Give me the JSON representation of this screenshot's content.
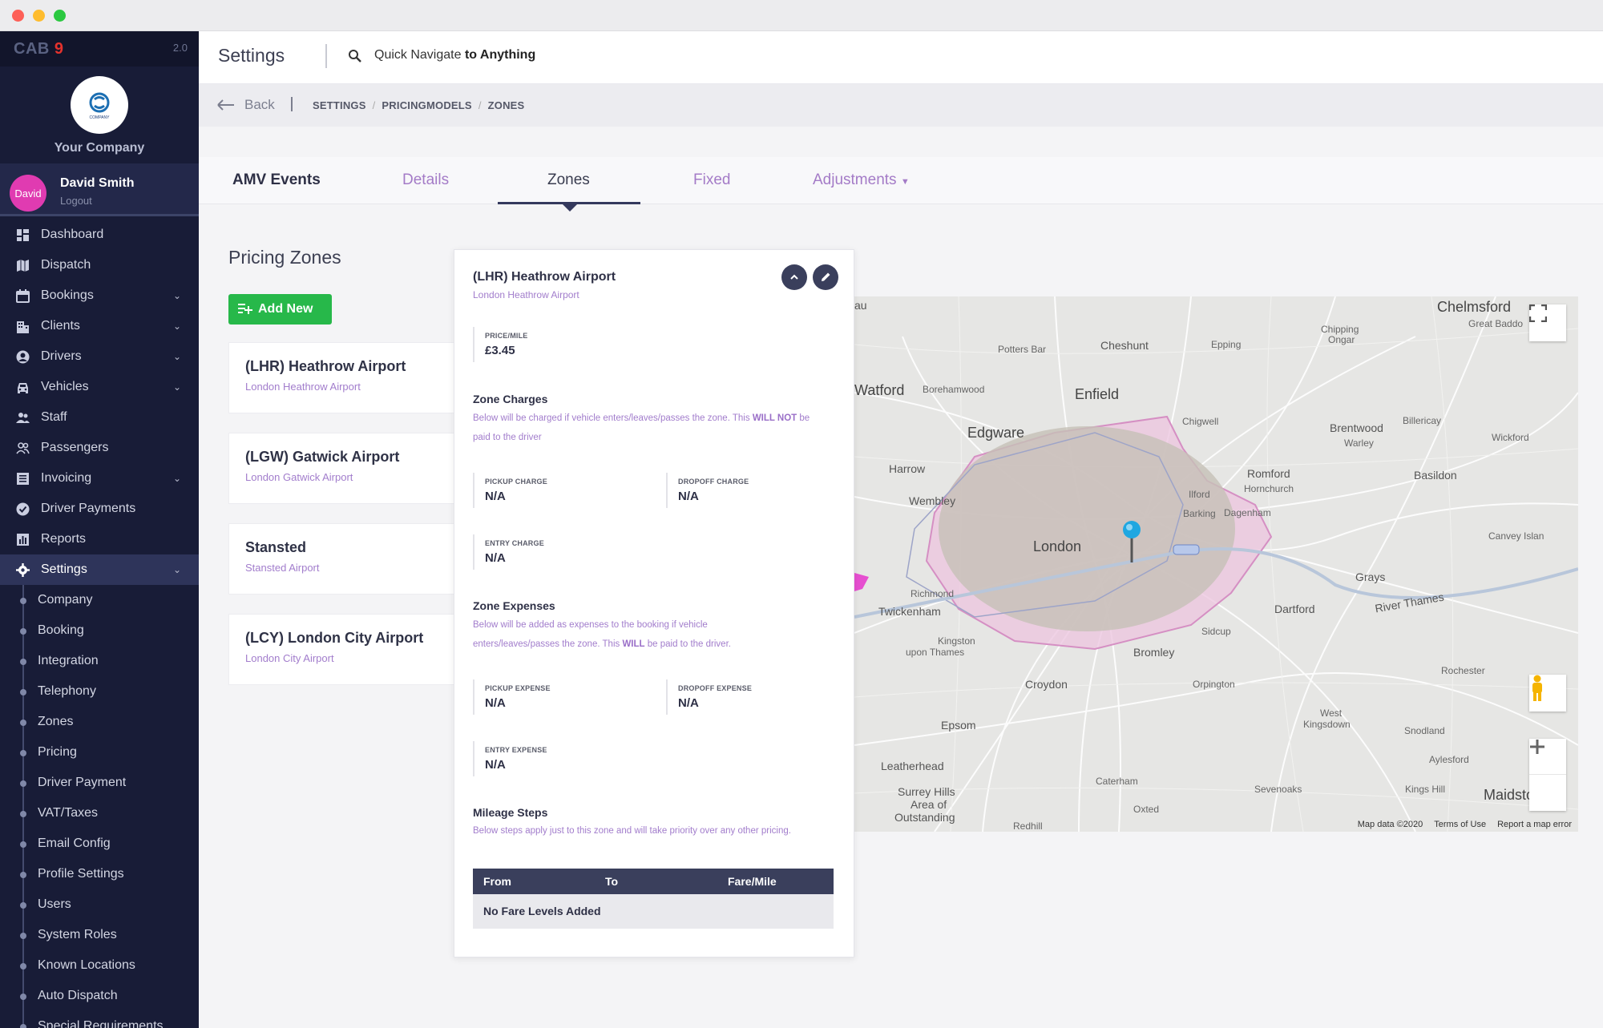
{
  "app": {
    "brand": "CAB",
    "brand_num": "9",
    "version": "2.0",
    "company_name": "Your Company",
    "logo_text": "COMPANY"
  },
  "user": {
    "avatar_text": "David",
    "name": "David Smith",
    "logout_label": "Logout"
  },
  "nav": {
    "dashboard": "Dashboard",
    "dispatch": "Dispatch",
    "bookings": "Bookings",
    "clients": "Clients",
    "drivers": "Drivers",
    "vehicles": "Vehicles",
    "staff": "Staff",
    "passengers": "Passengers",
    "invoicing": "Invoicing",
    "driver_payments": "Driver Payments",
    "reports": "Reports",
    "settings": "Settings"
  },
  "subnav": [
    "Company",
    "Booking",
    "Integration",
    "Telephony",
    "Zones",
    "Pricing",
    "Driver Payment",
    "VAT/Taxes",
    "Email Config",
    "Profile Settings",
    "Users",
    "System Roles",
    "Known Locations",
    "Auto Dispatch",
    "Special Requirements"
  ],
  "header": {
    "title": "Settings",
    "quick_nav_pre": "Quick Navigate ",
    "quick_nav_bold": "to Anything"
  },
  "breadcrumb": {
    "back": "Back",
    "items": [
      "SETTINGS",
      "PRICINGMODELS",
      "ZONES"
    ]
  },
  "tabs": {
    "title": "AMV Events",
    "details": "Details",
    "zones": "Zones",
    "fixed": "Fixed",
    "adjustments": "Adjustments"
  },
  "zones_page": {
    "title": "Pricing Zones",
    "add_new": "Add New",
    "zones": [
      {
        "name": "(LHR) Heathrow Airport",
        "sub": "London Heathrow Airport"
      },
      {
        "name": "(LGW) Gatwick Airport",
        "sub": "London Gatwick Airport"
      },
      {
        "name": "Stansted",
        "sub": "Stansted Airport"
      },
      {
        "name": "(LCY) London City Airport",
        "sub": "London City Airport"
      }
    ]
  },
  "detail": {
    "title": "(LHR) Heathrow Airport",
    "subtitle": "London Heathrow Airport",
    "price_label": "PRICE/MILE",
    "price_value": "£3.45",
    "charges_title": "Zone Charges",
    "charges_desc_1": "Below will be charged if vehicle enters/leaves/passes the zone. This ",
    "charges_desc_b1": "WILL NOT",
    "charges_desc_2": " be paid to the driver",
    "pickup_charge_label": "PICKUP CHARGE",
    "pickup_charge": "N/A",
    "dropoff_charge_label": "DROPOFF CHARGE",
    "dropoff_charge": "N/A",
    "entry_charge_label": "ENTRY CHARGE",
    "entry_charge": "N/A",
    "expenses_title": "Zone Expenses",
    "expenses_desc_1": "Below will be added as expenses to the booking if vehicle enters/leaves/passes the zone. This ",
    "expenses_desc_b1": "WILL",
    "expenses_desc_2": " be paid to the driver.",
    "pickup_expense_label": "PICKUP EXPENSE",
    "pickup_expense": "N/A",
    "dropoff_expense_label": "DROPOFF EXPENSE",
    "dropoff_expense": "N/A",
    "entry_expense_label": "ENTRY EXPENSE",
    "entry_expense": "N/A",
    "mileage_title": "Mileage Steps",
    "mileage_desc": "Below steps apply just to this zone and will take priority over any other pricing.",
    "table_headers": [
      "From",
      "To",
      "Fare/Mile"
    ],
    "table_empty": "No Fare Levels Added"
  },
  "map": {
    "labels": {
      "chelmsford": "Chelmsford",
      "great_baddow": "Great Baddo",
      "chipping_ongar": "Chipping\nOngar",
      "potters_bar": "Potters Bar",
      "cheshunt": "Cheshunt",
      "epping": "Epping",
      "watford": "Watford",
      "borehamwood": "Borehamwood",
      "enfield": "Enfield",
      "chigwell": "Chigwell",
      "brentwood": "Brentwood",
      "warley": "Warley",
      "billericay": "Billericay",
      "wickford": "Wickford",
      "edgware": "Edgware",
      "harrow": "Harrow",
      "wembley": "Wembley",
      "romford": "Romford",
      "hornchurch": "Hornchurch",
      "basildon": "Basildon",
      "ilford": "Ilford",
      "barking": "Barking",
      "dagenham": "Dagenham",
      "london": "London",
      "canvey": "Canvey Islan",
      "richmond": "Richmond",
      "twickenham": "Twickenham",
      "kingston": "Kingston\nupon Thames",
      "bromley": "Bromley",
      "sidcup": "Sidcup",
      "dartford": "Dartford",
      "grays": "Grays",
      "river_thames": "River Thames",
      "croydon": "Croydon",
      "orpington": "Orpington",
      "rochester": "Rochester",
      "epsom": "Epsom",
      "west_kingsdown": "West\nKingsdown",
      "snodland": "Snodland",
      "aylesford": "Aylesford",
      "leatherhead": "Leatherhead",
      "caterham": "Caterham",
      "surrey_hills": "Surrey Hills\nArea of\nOutstanding",
      "sevenoaks": "Sevenoaks",
      "kings_hill": "Kings Hill",
      "maidstone": "Maidsto",
      "oxted": "Oxted",
      "redhill": "Redhill"
    },
    "footer": [
      "Map data ©2020",
      "Terms of Use",
      "Report a map error"
    ],
    "colors": {
      "zone_outer": "#e8b6d9",
      "zone_inner": "#c6c2b8",
      "pin": "#1fa7e1"
    }
  }
}
